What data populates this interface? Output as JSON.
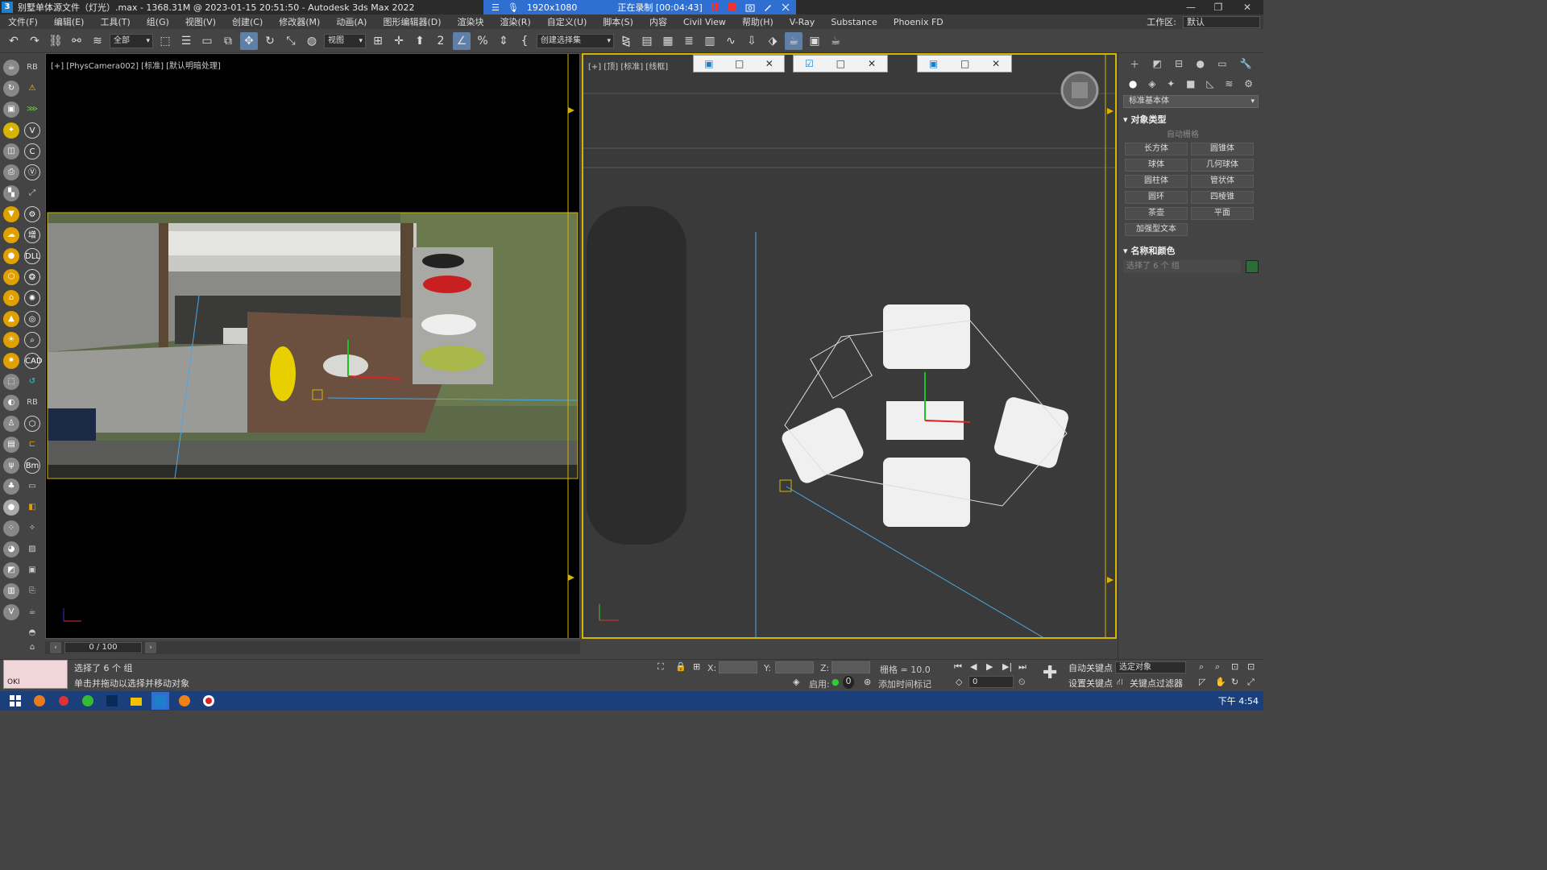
{
  "titlebar": {
    "app_badge": "3",
    "title": "别墅单体源文件（灯光）.max - 1368.31M @ 2023-01-15 20:51:50 - Autodesk 3ds Max 2022"
  },
  "recorder": {
    "resolution": "1920x1080",
    "status": "正在录制 [00:04:43]"
  },
  "menu": {
    "items": [
      "文件(F)",
      "编辑(E)",
      "工具(T)",
      "组(G)",
      "视图(V)",
      "创建(C)",
      "修改器(M)",
      "动画(A)",
      "图形编辑器(D)",
      "渲染块",
      "渲染(R)",
      "自定义(U)",
      "脚本(S)",
      "内容",
      "Civil View",
      "帮助(H)",
      "V-Ray",
      "Substance",
      "Phoenix FD"
    ],
    "workspace_label": "工作区:",
    "workspace_value": "默认"
  },
  "toolbar": {
    "filter_select": "全部",
    "view_select": "视图",
    "selection_set": "创建选择集"
  },
  "viewport_left": {
    "label": "[+] [PhysCamera002] [标准] [默认明暗处理]"
  },
  "viewport_right": {
    "label": "[+] [顶] [标准] [线框]"
  },
  "command_panel": {
    "category": "标准基本体",
    "object_type_title": "对象类型",
    "autogrid": "自动栅格",
    "buttons": [
      "长方体",
      "圆锥体",
      "球体",
      "几何球体",
      "圆柱体",
      "管状体",
      "圆环",
      "四棱锥",
      "茶壶",
      "平面",
      "加强型文本"
    ],
    "name_color_title": "名称和颜色",
    "name_field": "选择了 6 个 组"
  },
  "timeline": {
    "frame": "0 / 100"
  },
  "status": {
    "preview_text": "OKI",
    "selection": "选择了 6 个 组",
    "prompt": "单击并拖动以选择并移动对象",
    "x_label": "X:",
    "y_label": "Y:",
    "z_label": "Z:",
    "grid": "栅格 = 10.0",
    "enable": "启用:",
    "enable_value": "0",
    "add_time_tag": "添加时间标记",
    "auto_key": "自动关键点",
    "set_key": "设置关键点",
    "selected_object": "选定对象",
    "key_filters": "关键点过滤器",
    "frame_spinner": "0"
  },
  "taskbar": {
    "clock": "下午 4:54"
  },
  "colors": {
    "selection_yellow": "#d6b400",
    "recorder_blue": "#2f6fd1",
    "taskbar_blue": "#1a3f7a"
  }
}
